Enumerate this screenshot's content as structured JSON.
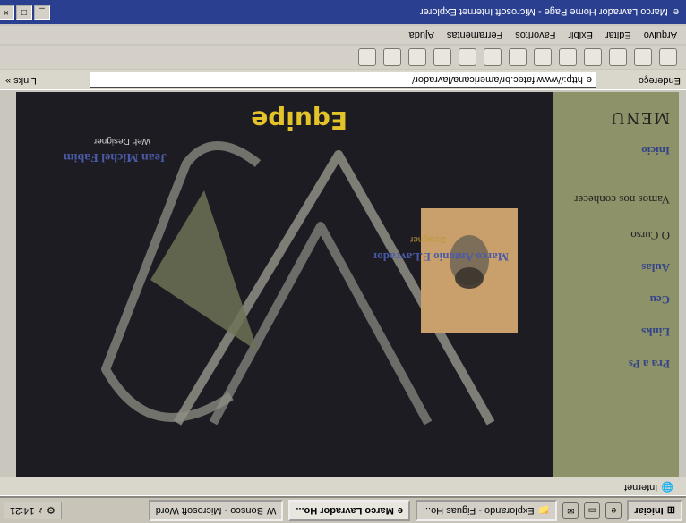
{
  "taskbar": {
    "start_label": "Iniciar",
    "tasks": [
      {
        "label": "Explorando - Figuas Ho...",
        "active": false
      },
      {
        "label": "Marco Lavrador Ho...",
        "active": true
      },
      {
        "label": "Bonsco - Microsoft Word",
        "active": false
      }
    ],
    "clock": "14:21"
  },
  "status": {
    "zone_label": "Internet"
  },
  "page": {
    "menu": {
      "title": "MENU",
      "items": [
        "Inicio",
        "Vamos nos conhecer",
        "O Curso",
        "Aulas",
        "Ceu",
        "Links",
        "Pra a Ps"
      ]
    },
    "heading": "Equipe",
    "people": [
      {
        "name": "Marco Antonio E.Lavrador",
        "role": "Designer"
      },
      {
        "name": "Jean Michel Fabim",
        "role": "Web Designer"
      }
    ]
  },
  "addressbar": {
    "label": "Endereço",
    "url": "http://www.fatec.br/americana/lavrador/",
    "links_label": "Links »"
  },
  "menubar": {
    "items": [
      "Arquivo",
      "Editar",
      "Exibir",
      "Favoritos",
      "Ferramentas",
      "Ajuda"
    ]
  },
  "titlebar": {
    "title": "Marco Lavrador Home Page - Microsoft Internet Explorer"
  }
}
